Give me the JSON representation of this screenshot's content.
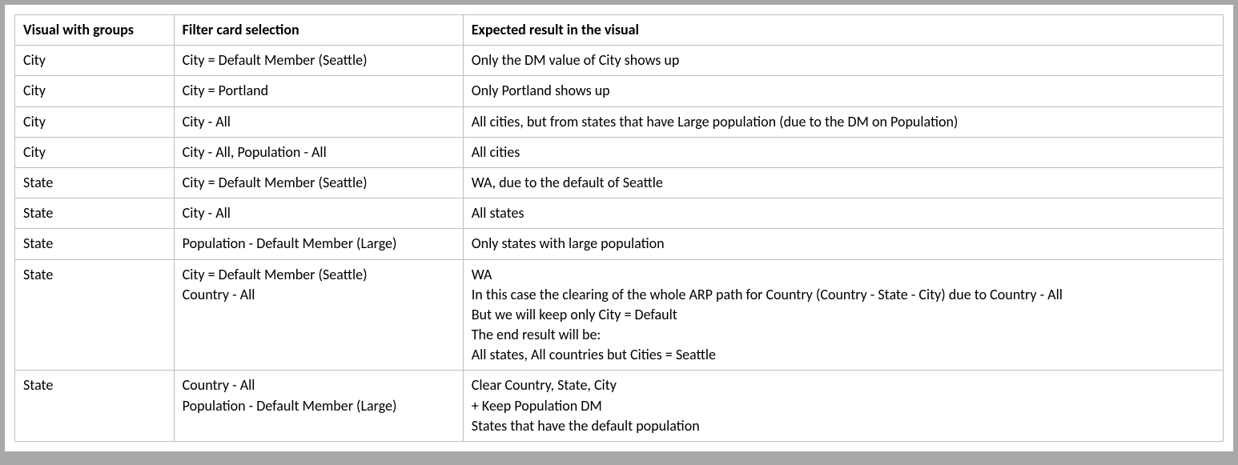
{
  "table": {
    "headers": {
      "col0": "Visual with groups",
      "col1": "Filter card selection",
      "col2": "Expected result in the visual"
    },
    "rows": [
      {
        "visual": "City",
        "filter": "City = Default Member (Seattle)",
        "result": "Only the DM value of City shows up"
      },
      {
        "visual": "City",
        "filter": "City = Portland",
        "result": "Only Portland shows up"
      },
      {
        "visual": "City",
        "filter": "City - All",
        "result": "All cities, but from states that have Large population (due to the DM on Population)"
      },
      {
        "visual": "City",
        "filter": "City - All, Population - All",
        "result": "All cities"
      },
      {
        "visual": "State",
        "filter": "City = Default Member (Seattle)",
        "result": "WA, due to the default of Seattle"
      },
      {
        "visual": "State",
        "filter": "City - All",
        "result": "All states"
      },
      {
        "visual": "State",
        "filter": "Population - Default Member (Large)",
        "result": "Only states with large population"
      },
      {
        "visual": "State",
        "filter": "City = Default Member (Seattle)\nCountry - All",
        "result": "WA\nIn this case the clearing of the whole ARP path for Country (Country - State - City) due to Country - All\nBut we will keep only City = Default\nThe end result will be:\nAll states, All countries but Cities = Seattle"
      },
      {
        "visual": "State",
        "filter": "Country - All\nPopulation - Default Member (Large)",
        "result": "Clear Country, State, City\n+ Keep Population DM\nStates that have the default population"
      }
    ]
  }
}
